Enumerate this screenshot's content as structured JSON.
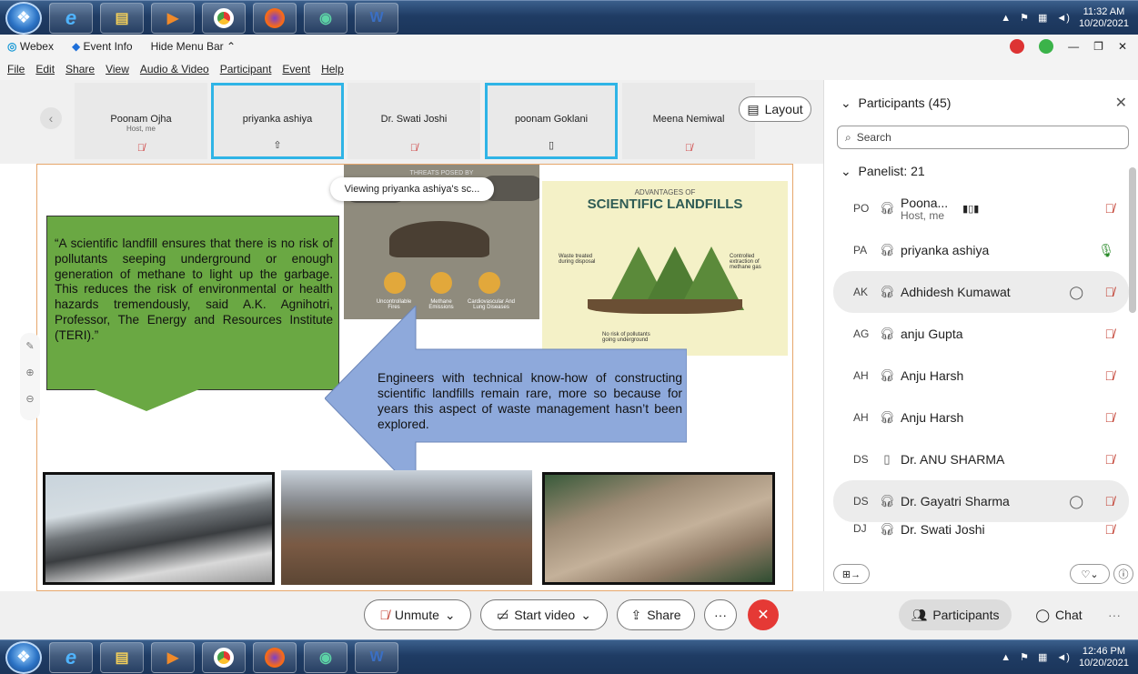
{
  "taskbar_top": {
    "time": "11:32 AM",
    "date": "10/20/2021"
  },
  "taskbar_bottom": {
    "time": "12:46 PM",
    "date": "10/20/2021"
  },
  "menu1": {
    "app": "Webex",
    "event_info": "Event Info",
    "hide_menu": "Hide Menu Bar"
  },
  "menu2": [
    "File",
    "Edit",
    "Share",
    "View",
    "Audio & Video",
    "Participant",
    "Event",
    "Help"
  ],
  "filmstrip": [
    {
      "name": "Poonam Ojha",
      "sub": "Host, me"
    },
    {
      "name": "priyanka ashiya",
      "sub": ""
    },
    {
      "name": "Dr. Swati Joshi",
      "sub": ""
    },
    {
      "name": "poonam Goklani",
      "sub": ""
    },
    {
      "name": "Meena Nemiwal",
      "sub": ""
    }
  ],
  "layout_label": "Layout",
  "toast": "Viewing priyanka ashiya's sc...",
  "slide": {
    "quote": "“A scientific landfill ensures that there is no risk of pollutants seeping underground or enough generation of methane to light up the garbage. This reduces the risk of environmental or health hazards tremendously, said A.K. Agnihotri, Professor, The Energy and Resources Institute (TERI).”",
    "blue_text": "Engineers with technical know-how of constructing scientific landfills remain rare, more so because for years this aspect of waste management hasn’t been explored.",
    "info1_title": "THREATS POSED BY",
    "info2_pre": "ADVANTAGES OF",
    "info2_title": "SCIENTIFIC LANDFILLS",
    "info2_labels": [
      "Waste treated during disposal",
      "Controlled extraction of methane gas",
      "No risk of pollutants going underground"
    ],
    "info1_labels": [
      "Uncontrollable Fires",
      "Methane Emissions",
      "Cardiovascular And Lung Diseases"
    ]
  },
  "panel": {
    "title": "Participants (45)",
    "search_placeholder": "Search",
    "section": "Panelist: 21",
    "rows": [
      {
        "initials": "PO",
        "name": "Poona...",
        "sub": "Host, me"
      },
      {
        "initials": "PA",
        "name": "priyanka ashiya",
        "sub": ""
      },
      {
        "initials": "AK",
        "name": "Adhidesh Kumawat",
        "sub": ""
      },
      {
        "initials": "AG",
        "name": "anju Gupta",
        "sub": ""
      },
      {
        "initials": "AH",
        "name": "Anju Harsh",
        "sub": ""
      },
      {
        "initials": "AH",
        "name": "Anju Harsh",
        "sub": ""
      },
      {
        "initials": "DS",
        "name": "Dr. ANU SHARMA",
        "sub": ""
      },
      {
        "initials": "DS",
        "name": "Dr. Gayatri Sharma",
        "sub": ""
      },
      {
        "initials": "DJ",
        "name": "Dr. Swati Joshi",
        "sub": ""
      }
    ]
  },
  "controls": {
    "unmute": "Unmute",
    "start_video": "Start video",
    "share": "Share",
    "participants": "Participants",
    "chat": "Chat"
  }
}
